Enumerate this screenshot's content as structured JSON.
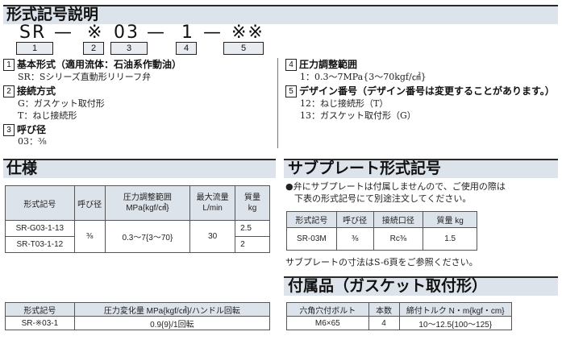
{
  "model_section": {
    "title": "形式記号説明",
    "code": {
      "p1": "SR",
      "d1": "—",
      "p2": "※",
      "p3": "03",
      "d2": "—",
      "p4": "1",
      "d3": "—",
      "p5": "※※"
    },
    "code_boxes": [
      "1",
      "2",
      "3",
      "4",
      "5"
    ],
    "items": [
      {
        "num": "1",
        "head": "基本形式（適用流体：石油系作動油）",
        "lines": [
          "SR：Sシリーズ直動形リリーフ弁"
        ]
      },
      {
        "num": "2",
        "head": "接続方式",
        "lines": [
          "G：ガスケット取付形",
          "T：ねじ接続形"
        ]
      },
      {
        "num": "3",
        "head": "呼び径",
        "lines": [
          "03：⅜"
        ]
      },
      {
        "num": "4",
        "head": "圧力調整範囲",
        "lines": [
          "1：0.3～7MPa{3～70kgf/㎠}"
        ]
      },
      {
        "num": "5",
        "head": "デザイン番号（デザイン番号は変更することがあります。）",
        "lines": [
          "12：ねじ接続形（T）",
          "13：ガスケット取付形（G）"
        ]
      }
    ]
  },
  "spec_section": {
    "title": "仕様",
    "headers": [
      "形式記号",
      "呼び径",
      "圧力調整範囲\nMPa{kgf/㎠}",
      "最大流量\nL/min",
      "質量\nkg"
    ],
    "rows": [
      {
        "model": "SR-G03-1-13",
        "mass": "2.5"
      },
      {
        "model": "SR-T03-1-12",
        "mass": "2"
      }
    ],
    "shared": {
      "size": "⅜",
      "pressure": "0.3～7{3～70}",
      "flow": "30"
    }
  },
  "subplate_section": {
    "title": "サブプレート形式記号",
    "note_lines": [
      "●弁にサブプレートは付属しませんので、ご使用の際は",
      "　下表の形式記号にて別途注文してください。"
    ],
    "headers": [
      "形式記号",
      "呼び径",
      "接続口径",
      "質量 kg"
    ],
    "row": {
      "model": "SR-03M",
      "size": "⅜",
      "port": "Rc⅜",
      "mass": "1.5"
    },
    "footnote": "サブプレートの寸法はS-6頁をご参照ください。"
  },
  "pressure_table": {
    "headers": [
      "形式記号",
      "圧力変化量 MPa{kgf/㎠}/ハンドル回転"
    ],
    "row": {
      "model": "SR-※03-1",
      "value": "0.9{9}/1回転"
    }
  },
  "accessory_section": {
    "title": "付属品（ガスケット取付形）",
    "headers": [
      "六角穴付ボルト",
      "本数",
      "締付トルク N・m{kgf・cm}"
    ],
    "row": {
      "bolt": "M6×65",
      "qty": "4",
      "torque": "10～12.5{100～125}"
    }
  }
}
